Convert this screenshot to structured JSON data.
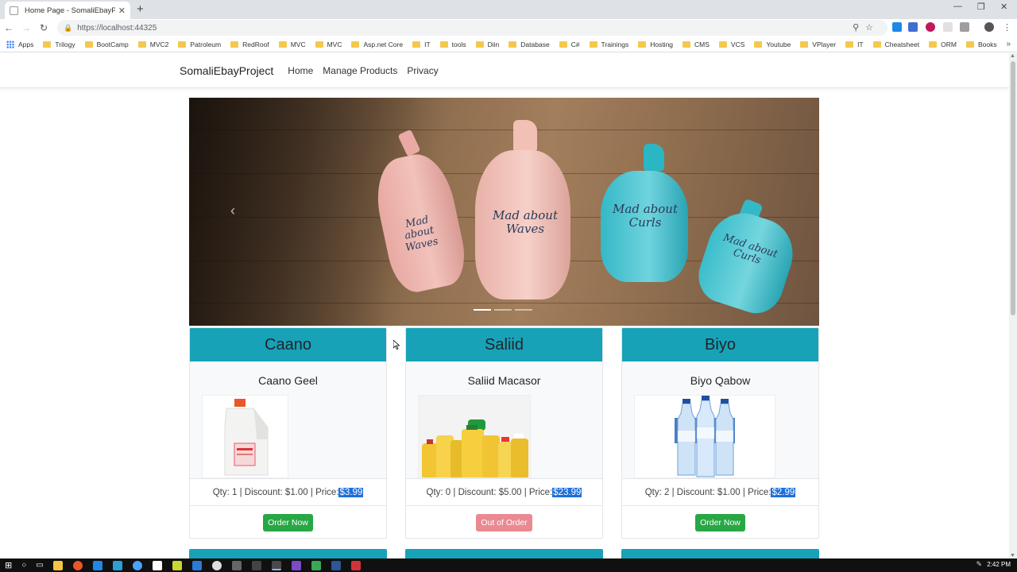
{
  "browser": {
    "tab_title": "Home Page - SomaliEbayProject",
    "url": "https://localhost:44325",
    "bookmarks": [
      "Apps",
      "Trilogy",
      "BootCamp",
      "MVC2",
      "Patroleum",
      "RedRoof",
      "MVC",
      "MVC",
      "Asp.net Core",
      "IT",
      "tools",
      "Diin",
      "Database",
      "C#",
      "Trainings",
      "Hosting",
      "CMS",
      "VCS",
      "Youtube",
      "VPlayer",
      "IT",
      "Cheatsheet",
      "ORM",
      "Books"
    ]
  },
  "navbar": {
    "brand": "SomaliEbayProject",
    "links": [
      "Home",
      "Manage Products",
      "Privacy"
    ]
  },
  "carousel": {
    "labels": [
      "Mad about Waves",
      "Mad about Waves",
      "Mad about Curls",
      "Mad about Curls"
    ],
    "active_index": 0,
    "indicator_count": 3
  },
  "products": [
    {
      "category": "Caano",
      "name": "Caano Geel",
      "qty_text": "Qty: 1 | Discount: $1.00 | Price: ",
      "price": "$3.99",
      "button": "Order Now",
      "in_stock": true
    },
    {
      "category": "Saliid",
      "name": "Saliid Macasor",
      "qty_text": "Qty: 0 | Discount: $5.00 | Price: ",
      "price": "$23.99",
      "button": "Out of Order",
      "in_stock": false
    },
    {
      "category": "Biyo",
      "name": "Biyo Qabow",
      "qty_text": "Qty: 2 | Discount: $1.00 | Price: ",
      "price": "$2.99",
      "button": "Order Now",
      "in_stock": true
    }
  ],
  "taskbar": {
    "time": "2:42 PM"
  },
  "colors": {
    "card_header": "#17a2b8",
    "order_button": "#28a745",
    "out_button": "#e98a92",
    "price_highlight": "#1e6fd9"
  }
}
